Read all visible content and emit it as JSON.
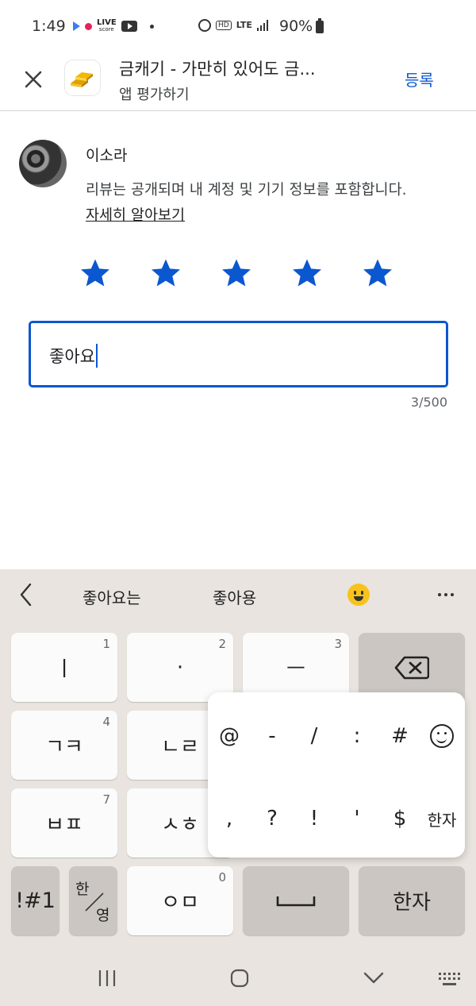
{
  "status_bar": {
    "time": "1:49",
    "live_label": "LIVE",
    "live_sub": "score",
    "hd_label": "HD",
    "lte_label": "LTE",
    "battery_pct": "90%"
  },
  "header": {
    "app_title": "금캐기 - 가만히 있어도 금...",
    "subtitle": "앱 평가하기",
    "post_label": "등록"
  },
  "reviewer": {
    "name": "이소라",
    "notice": "리뷰는 공개되며 내 계정 및 기기 정보를 포함합니다.",
    "learn_more": "자세히 알아보기"
  },
  "rating": {
    "value": 5,
    "max": 5,
    "color": "#0b57d0"
  },
  "review": {
    "text": "좋아요",
    "counter": "3/500"
  },
  "keyboard": {
    "suggestions": [
      "좋아요는",
      "좋아용"
    ],
    "rows": [
      [
        {
          "label": "ㅣ",
          "num": "1"
        },
        {
          "label": "·",
          "num": "2"
        },
        {
          "label": "ㅡ",
          "num": "3"
        }
      ],
      [
        {
          "label": "ㄱㅋ",
          "num": "4"
        },
        {
          "label": "ㄴㄹ",
          "num": ""
        }
      ],
      [
        {
          "label": "ㅂㅍ",
          "num": "7"
        },
        {
          "label": "ㅅㅎ",
          "num": ""
        }
      ],
      [
        {
          "label": "ㅇㅁ",
          "num": "0"
        }
      ]
    ],
    "symbols_label": "!#1",
    "lang_top": "한",
    "lang_bottom": "영",
    "hanja_label": "한자",
    "popup_row1": [
      "@",
      "-",
      "/",
      ":",
      "#"
    ],
    "popup_row2": [
      ",",
      "?",
      "!",
      "'",
      "$"
    ],
    "popup_hanja": "한자"
  }
}
